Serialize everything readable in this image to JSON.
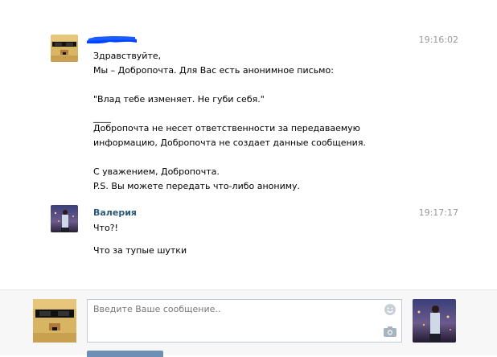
{
  "conversation": {
    "messages": [
      {
        "author": "",
        "time": "19:16:02",
        "lines": [
          "Здравствуйте,",
          "Мы – Добропочта. Для Вас есть анонимное письмо:",
          "",
          "\"Влад тебе изменяет. Не губи себя.\"",
          "",
          "____",
          "Добропочта не несет ответственности за передаваемую",
          "информацию, Добропочта не создает данные сообщения.",
          "",
          "С уважением, Добропочта.",
          "P.S. Вы можете передать что-либо анониму."
        ]
      },
      {
        "author": "Валерия",
        "time": "19:17:17",
        "lines": [
          "Что?!",
          "",
          "Что за тупые шутки"
        ]
      }
    ]
  },
  "composer": {
    "placeholder": "Введите Ваше сообщение.."
  },
  "icons": {
    "emoji": "smiley-icon",
    "attach_photo": "camera-icon"
  },
  "colors": {
    "author_link": "#2b587a",
    "redaction": "#0044ff",
    "send_button": "#6d8fb3"
  }
}
